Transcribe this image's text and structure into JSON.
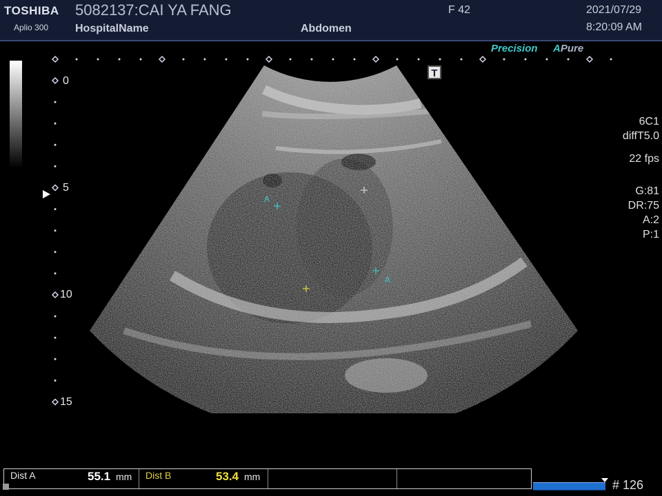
{
  "header": {
    "manufacturer": "TOSHIBA",
    "model": "Aplio 300",
    "patient": "5082137:CAI YA FANG",
    "hospital": "HospitalName",
    "exam": "Abdomen",
    "sex_age": "F  42",
    "date": "2021/07/29",
    "time": "8:20:09 AM"
  },
  "brand_tags": {
    "precision": "Precision",
    "pure": "Pure",
    "a_letter": "A"
  },
  "t_marker": "T",
  "depth_scale": {
    "labels": [
      "0",
      "5",
      "10",
      "15"
    ]
  },
  "imaging_params": {
    "probe": "6C1",
    "mode": "diffT5.0",
    "frame_rate": "22 fps",
    "gain": "G:81",
    "dynamic_range": "DR:75",
    "a_value": "A:2",
    "p_value": "P:1"
  },
  "calipers": {
    "a_label": "A",
    "a_label_2": "A"
  },
  "measurements": {
    "dist_a_label": "Dist A",
    "dist_a_value": "55.1",
    "dist_b_label": "Dist B",
    "dist_b_value": "53.4",
    "unit": "mm"
  },
  "cine": {
    "frame": "# 126"
  },
  "colors": {
    "header_bg": "#141c33",
    "caliper_a": "#3fc9c9",
    "caliper_b": "#e0d040",
    "cine_bar": "#1f6fd1"
  }
}
